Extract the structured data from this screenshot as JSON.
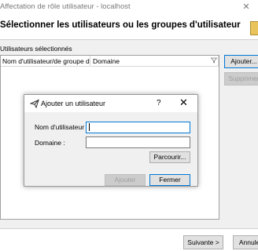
{
  "window": {
    "title": "Affectation de rôle utilisateur - localhost",
    "close_glyph": "✕",
    "header": "Sélectionner les utilisateurs ou les groupes d'utilisateur"
  },
  "selection": {
    "label": "Utilisateurs sélectionnés",
    "columns": [
      "Nom d'utilisateur/de groupe d'utili",
      "Domaine"
    ],
    "rows": []
  },
  "side_buttons": {
    "add": "Ajouter...",
    "remove": "Supprimer"
  },
  "footer": {
    "next": "Suivante >",
    "cancel": "Annuler"
  },
  "dialog": {
    "title": "Ajouter un utilisateur",
    "help": "?",
    "close": "✕",
    "username_label": "Nom d'utilisateur :",
    "username_value": "",
    "domain_label": "Domaine :",
    "domain_value": "",
    "browse": "Parcourir...",
    "add": "Ajouter",
    "close_button": "Fermer"
  },
  "icons": {
    "dialog_icon": "paper-plane-icon",
    "filter_icon": "filter-icon",
    "header_icon": "folder-icon"
  },
  "colors": {
    "focus_border": "#0078d7",
    "title_text": "#7a7a7a"
  }
}
